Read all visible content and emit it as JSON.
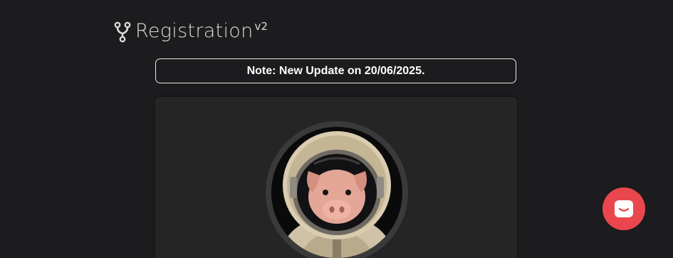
{
  "brand": {
    "title": "Registration",
    "version": "v2",
    "icon": "fork-icon"
  },
  "notice": {
    "text": "Note: New Update on 20/06/2025."
  },
  "profile": {
    "avatar": "astronaut-pig-avatar"
  },
  "chat": {
    "icon": "chat-bubble-icon",
    "color": "#e9474d"
  },
  "colors": {
    "background": "#1c1b1d",
    "card": "#252525",
    "text": "#dadada"
  }
}
